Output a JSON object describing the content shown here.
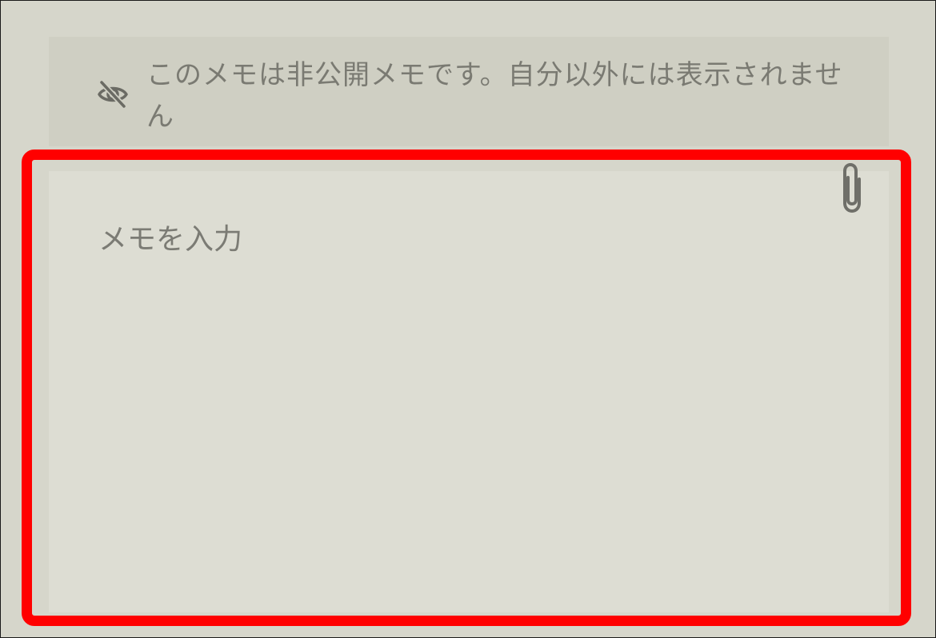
{
  "notice": {
    "icon": "eye-off-icon",
    "text": "このメモは非公開メモです。自分以外には表示されません"
  },
  "memo": {
    "placeholder": "メモを入力",
    "value": "",
    "attach_icon": "paperclip-icon"
  },
  "colors": {
    "page_background": "#d6d6cb",
    "notice_background": "#cfcfc3",
    "memo_background": "#ddddd3",
    "highlight": "#ff0000",
    "text_muted": "#7a7a72"
  }
}
